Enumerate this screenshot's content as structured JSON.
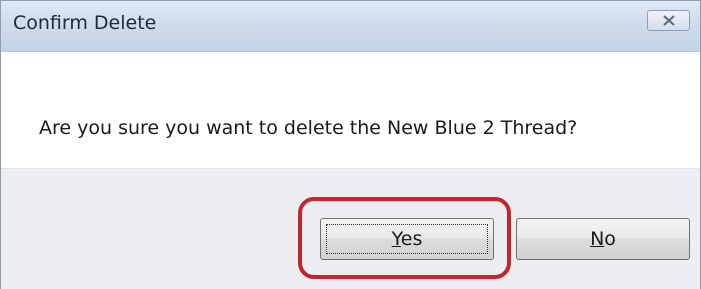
{
  "window": {
    "title": "Confirm Delete",
    "close_icon": "close-icon"
  },
  "message": "Are you sure you want to delete the New Blue 2 Thread?",
  "buttons": {
    "yes": {
      "first": "Y",
      "rest": "es"
    },
    "no": {
      "first": "N",
      "rest": "o"
    }
  },
  "colors": {
    "highlight": "#c4262e",
    "titlebar": "#cfdcec",
    "footer": "#eceef2"
  }
}
